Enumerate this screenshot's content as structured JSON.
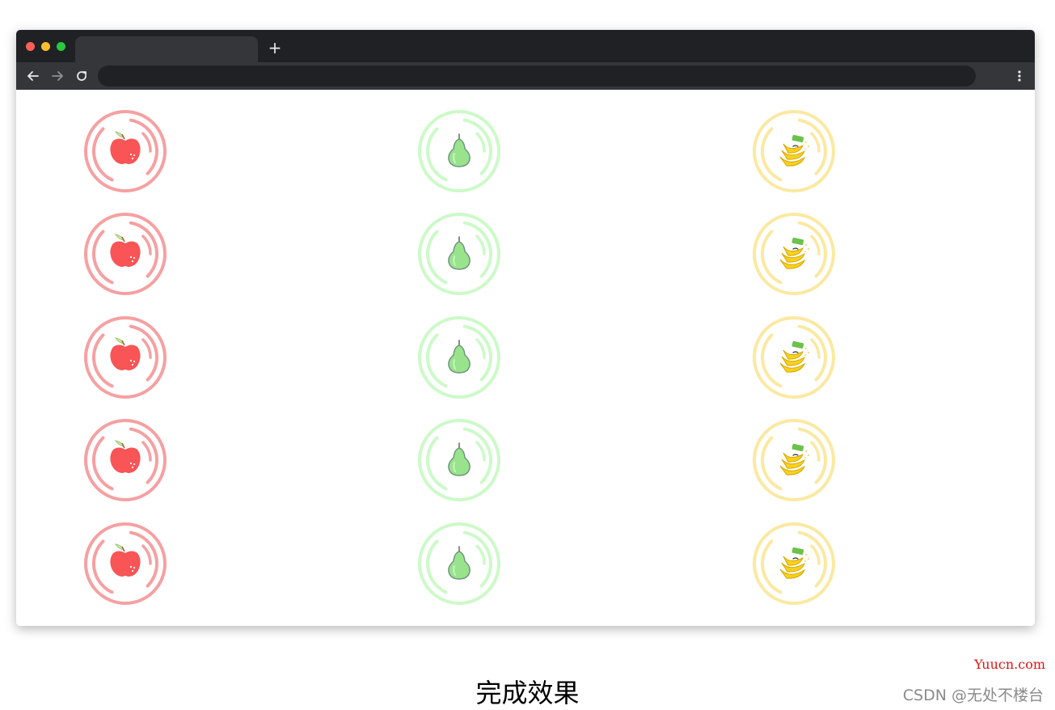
{
  "browser": {
    "active_tab_title": "",
    "new_tab_label": "+",
    "address_bar_value": ""
  },
  "fruit_grid": {
    "rows": 5,
    "columns": [
      {
        "fruit": "apple",
        "ring_color": "#f6a0a2",
        "body_color": "#f95456"
      },
      {
        "fruit": "pear",
        "ring_color": "#ccfac8",
        "body_color": "#98e38c"
      },
      {
        "fruit": "banana",
        "ring_color": "#fbe9a2",
        "body_color": "#f7d21c"
      }
    ]
  },
  "caption": "完成效果",
  "watermarks": {
    "site": "Yuucn.com",
    "author": "CSDN @无处不楼台"
  }
}
